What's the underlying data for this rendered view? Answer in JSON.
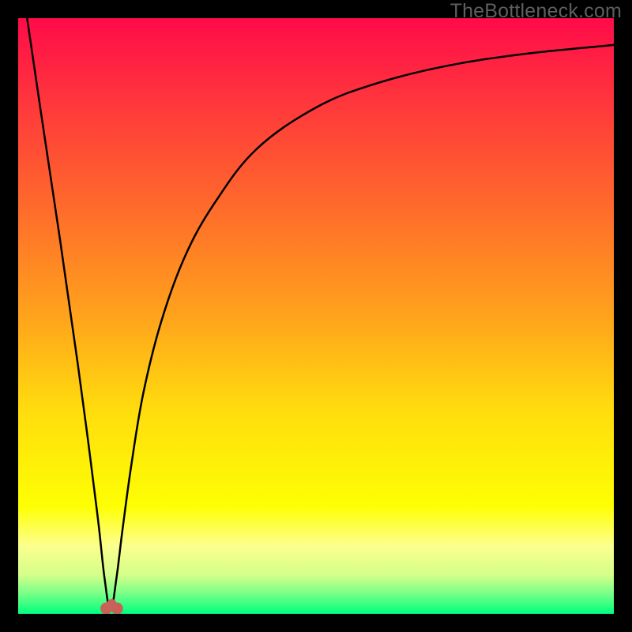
{
  "watermark": "TheBottleneck.com",
  "chart_data": {
    "type": "line",
    "title": "",
    "xlabel": "",
    "ylabel": "",
    "xlim": [
      0,
      1
    ],
    "ylim": [
      0,
      1
    ],
    "x_of_minimum": 0.155,
    "gradient_stops": [
      {
        "offset": 0.0,
        "color": "#ff0b49"
      },
      {
        "offset": 0.16,
        "color": "#ff3c3a"
      },
      {
        "offset": 0.33,
        "color": "#ff6e2a"
      },
      {
        "offset": 0.5,
        "color": "#ffa31c"
      },
      {
        "offset": 0.66,
        "color": "#ffdd0d"
      },
      {
        "offset": 0.82,
        "color": "#feff03"
      },
      {
        "offset": 0.885,
        "color": "#fdff8e"
      },
      {
        "offset": 0.935,
        "color": "#d3ff89"
      },
      {
        "offset": 0.965,
        "color": "#7bff88"
      },
      {
        "offset": 1.0,
        "color": "#00ff7f"
      }
    ],
    "series": [
      {
        "name": "curve",
        "x": [
          0.015,
          0.04,
          0.07,
          0.1,
          0.12,
          0.135,
          0.145,
          0.155,
          0.165,
          0.175,
          0.19,
          0.21,
          0.24,
          0.28,
          0.33,
          0.4,
          0.5,
          0.6,
          0.72,
          0.85,
          1.0
        ],
        "y": [
          1.0,
          0.83,
          0.63,
          0.42,
          0.27,
          0.15,
          0.06,
          0.005,
          0.06,
          0.14,
          0.25,
          0.37,
          0.49,
          0.6,
          0.69,
          0.78,
          0.85,
          0.89,
          0.92,
          0.94,
          0.955
        ]
      }
    ],
    "markers": [
      {
        "name": "min-dot-left",
        "x": 0.148,
        "y": 0.009,
        "r": 0.01,
        "color": "#c86158"
      },
      {
        "name": "min-dot-right",
        "x": 0.166,
        "y": 0.009,
        "r": 0.01,
        "color": "#c86158"
      },
      {
        "name": "min-bridge",
        "x": 0.157,
        "y": 0.017,
        "r": 0.008,
        "color": "#c86158"
      }
    ]
  }
}
